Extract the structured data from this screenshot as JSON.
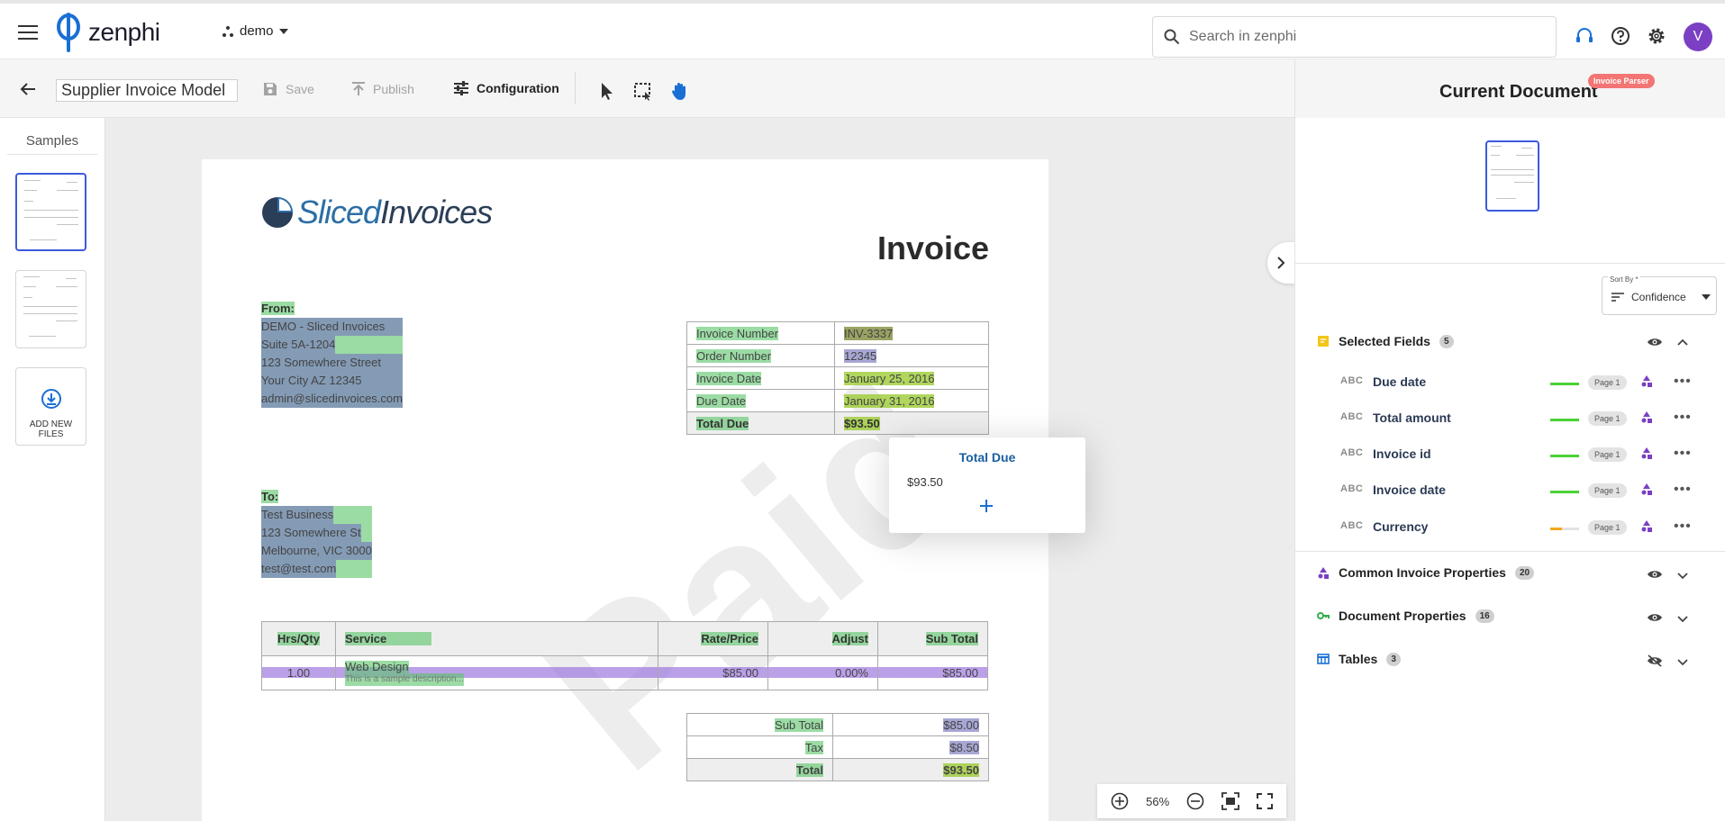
{
  "app": {
    "brand": "zenphi",
    "workspace": "demo",
    "search_placeholder": "Search in zenphi",
    "avatar_initial": "V"
  },
  "toolbar": {
    "model_name": "Supplier Invoice Model",
    "save_label": "Save",
    "publish_label": "Publish",
    "configuration_label": "Configuration"
  },
  "samples": {
    "title": "Samples",
    "add_label": "ADD NEW FILES"
  },
  "document": {
    "brand_a": "Sliced",
    "brand_b": "Invoices",
    "title": "Invoice",
    "from_label": "From:",
    "from_lines": [
      "DEMO - Sliced Invoices",
      "Suite 5A-1204",
      "123 Somewhere Street",
      "Your City AZ 12345",
      "admin@slicedinvoices.com"
    ],
    "to_label": "To:",
    "to_lines": [
      "Test Business",
      "123 Somewhere St",
      "Melbourne, VIC 3000",
      "test@test.com"
    ],
    "info_rows": [
      {
        "label": "Invoice Number",
        "value": "INV-3337"
      },
      {
        "label": "Order Number",
        "value": "12345"
      },
      {
        "label": "Invoice Date",
        "value": "January 25, 2016"
      },
      {
        "label": "Due Date",
        "value": "January 31, 2016"
      },
      {
        "label": "Total Due",
        "value": "$93.50"
      }
    ],
    "items_headers": [
      "Hrs/Qty",
      "Service",
      "Rate/Price",
      "Adjust",
      "Sub Total"
    ],
    "item": {
      "qty": "1.00",
      "service": "Web Design",
      "description": "This is a sample description...",
      "rate": "$85.00",
      "adjust": "0.00%",
      "subtotal": "$85.00"
    },
    "totals": [
      {
        "label": "Sub Total",
        "value": "$85.00"
      },
      {
        "label": "Tax",
        "value": "$8.50"
      },
      {
        "label": "Total",
        "value": "$93.50"
      }
    ],
    "watermark": "Paid"
  },
  "popup": {
    "title": "Total Due",
    "value": "$93.50"
  },
  "zoom": {
    "level": "56%"
  },
  "panel": {
    "title": "Current Document",
    "badge": "Invoice Parser",
    "sort_label": "Sort By *",
    "sort_value": "Confidence",
    "selected_title": "Selected Fields",
    "selected_count": "5",
    "fields": [
      {
        "type": "ABC",
        "name": "Due date",
        "page": "Page 1",
        "confidence": 1.0,
        "color": "#4cd137"
      },
      {
        "type": "ABC",
        "name": "Total amount",
        "page": "Page 1",
        "confidence": 1.0,
        "color": "#4cd137"
      },
      {
        "type": "ABC",
        "name": "Invoice id",
        "page": "Page 1",
        "confidence": 1.0,
        "color": "#4cd137"
      },
      {
        "type": "ABC",
        "name": "Invoice date",
        "page": "Page 1",
        "confidence": 1.0,
        "color": "#4cd137"
      },
      {
        "type": "ABC",
        "name": "Currency",
        "page": "Page 1",
        "confidence": 0.4,
        "color": "#f5a623"
      }
    ],
    "common_title": "Common Invoice Properties",
    "common_count": "20",
    "docprops_title": "Document Properties",
    "docprops_count": "16",
    "tables_title": "Tables",
    "tables_count": "3"
  },
  "colors": {
    "accent": "#3b5bdb",
    "avatar": "#7b3fc4",
    "badge": "#f27573",
    "icon_blue": "#1a6fd4"
  }
}
